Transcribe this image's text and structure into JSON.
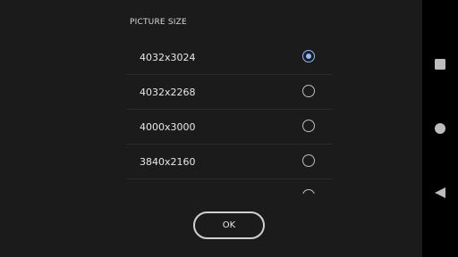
{
  "dialog": {
    "title": "PICTURE SIZE",
    "options": [
      {
        "label": "4032x3024",
        "selected": true
      },
      {
        "label": "4032x2268",
        "selected": false
      },
      {
        "label": "4000x3000",
        "selected": false
      },
      {
        "label": "3840x2160",
        "selected": false
      }
    ],
    "ok_label": "OK"
  },
  "navbar": {
    "buttons": [
      "recents-icon",
      "home-icon",
      "back-icon"
    ]
  },
  "colors": {
    "accent": "#8fb8ff",
    "panel": "#1b1b1b",
    "navbar": "#000000"
  }
}
